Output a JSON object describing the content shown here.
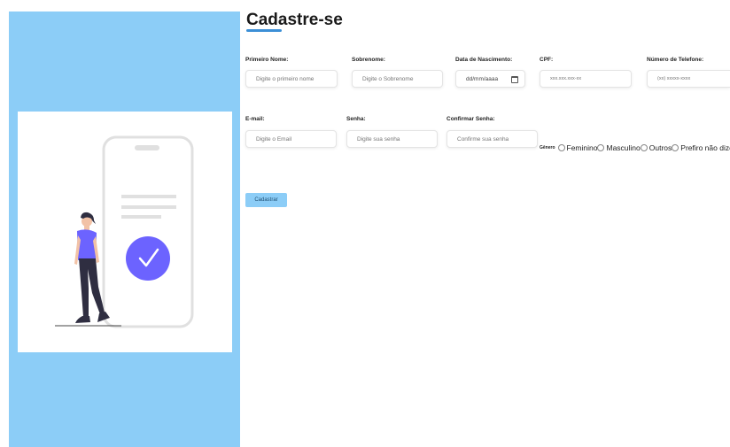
{
  "form": {
    "title": "Cadastre-se",
    "fields": {
      "first_name": {
        "label": "Primeiro Nome:",
        "placeholder": "Digite o primeiro nome"
      },
      "last_name": {
        "label": "Sobrenome:",
        "placeholder": "Digite o Sobrenome"
      },
      "birth_date": {
        "label": "Data de Nascimento:",
        "value": "dd/mm/aaaa"
      },
      "cpf": {
        "label": "CPF:",
        "placeholder": "xxx.xxx.xxx-xx"
      },
      "phone": {
        "label": "Número de Telefone:",
        "placeholder": "(xx) xxxxx-xxxx"
      },
      "email": {
        "label": "E-mail:",
        "placeholder": "Digite o Email"
      },
      "password": {
        "label": "Senha:",
        "placeholder": "Digite sua senha"
      },
      "confirm_password": {
        "label": "Confirmar Senha:",
        "placeholder": "Confirme sua senha"
      }
    },
    "gender": {
      "label": "Gênero",
      "options": [
        "Feminino",
        "Masculino",
        "Outros",
        "Prefiro não dizer"
      ]
    },
    "submit_label": "Cadastrar"
  },
  "colors": {
    "panel_bg": "#8ccdf7",
    "accent": "#3c8fd6",
    "check_circle": "#6c63ff"
  },
  "illustration": {
    "icons": [
      "phone-icon",
      "check-icon",
      "person-icon"
    ]
  }
}
